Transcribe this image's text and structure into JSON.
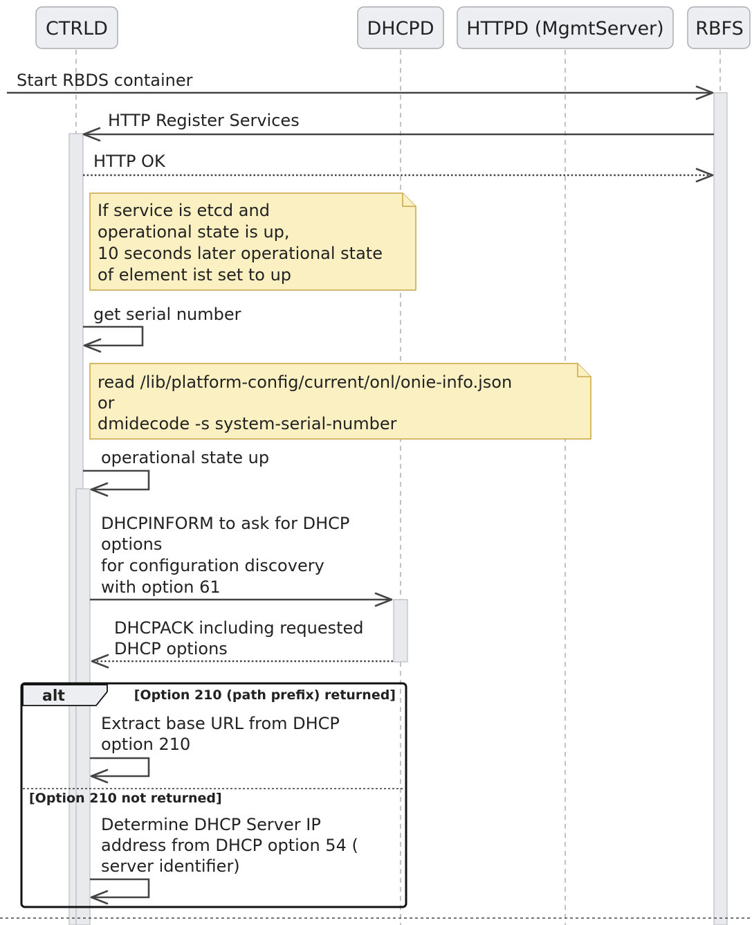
{
  "participants": [
    {
      "id": "ctrld",
      "label": "CTRLD"
    },
    {
      "id": "dhcpd",
      "label": "DHCPD"
    },
    {
      "id": "httpd",
      "label": "HTTPD (MgmtServer)"
    },
    {
      "id": "rbfs",
      "label": "RBFS"
    }
  ],
  "messages": [
    {
      "id": "start-rbds",
      "label": "Start RBDS container"
    },
    {
      "id": "http-register",
      "label": "HTTP Register Services"
    },
    {
      "id": "http-ok",
      "label": "HTTP OK"
    },
    {
      "id": "get-serial",
      "label": "get serial number"
    },
    {
      "id": "op-state-up",
      "label": "operational state up"
    },
    {
      "id": "dhcpinform",
      "lines": [
        "DHCPINFORM to ask for DHCP",
        "options",
        "for configuration discovery",
        "with option 61"
      ]
    },
    {
      "id": "dhcpack",
      "lines": [
        "DHCPACK including requested",
        "DHCP options"
      ]
    },
    {
      "id": "extract-url",
      "lines": [
        "Extract base URL from DHCP",
        "option 210"
      ]
    },
    {
      "id": "determine-ip",
      "lines": [
        "Determine DHCP Server IP",
        "address from DHCP option 54 (",
        "server identifier)"
      ]
    }
  ],
  "notes": [
    {
      "id": "etcd-note",
      "lines": [
        "If service is etcd and",
        "operational state is up,",
        "10 seconds later operational state",
        "of element ist set to up"
      ]
    },
    {
      "id": "serial-note",
      "lines": [
        "read /lib/platform-config/current/onl/onie-info.json",
        "or",
        "dmidecode -s system-serial-number"
      ]
    }
  ],
  "alt_group": {
    "keyword": "alt",
    "guard": "[Option 210 (path prefix) returned]",
    "else_guard": "[Option 210 not returned]"
  },
  "colors": {
    "note_fill": "#fbf0c2",
    "note_border": "#c9a645",
    "participant_fill": "#eceef1",
    "arrow": "#444444"
  }
}
